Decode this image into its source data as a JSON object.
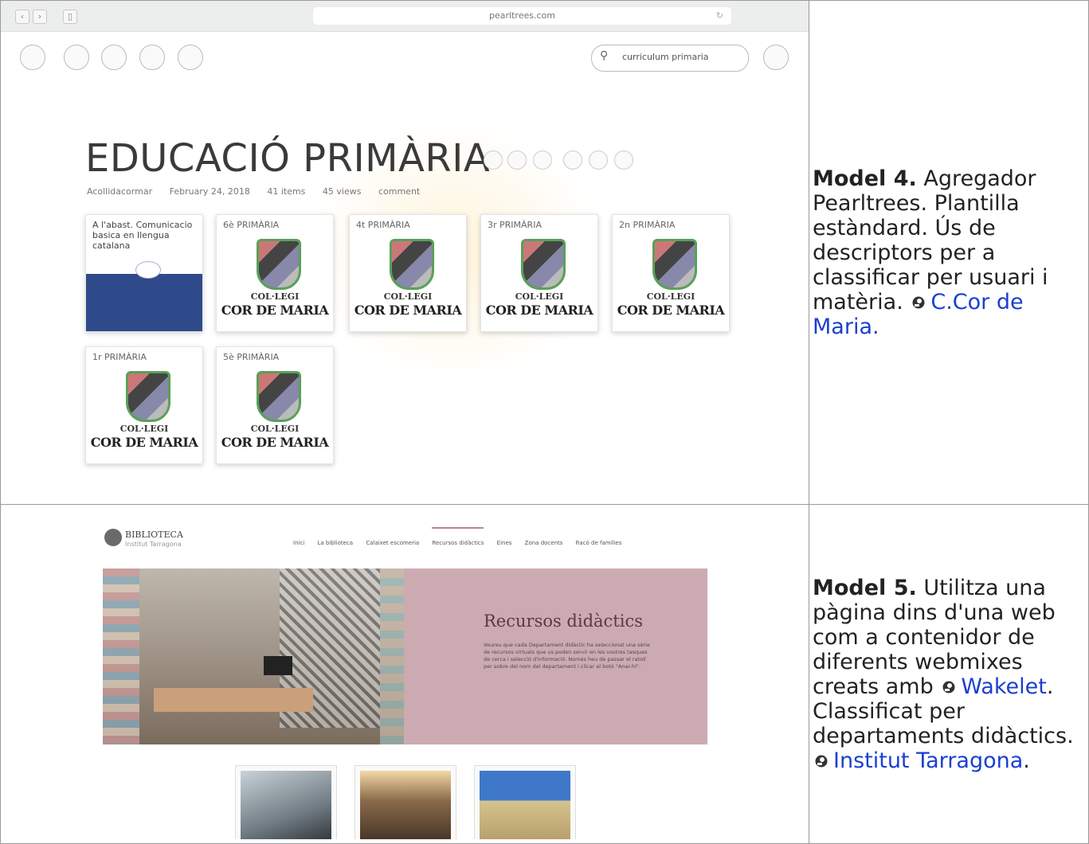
{
  "rows": [
    {
      "browser_url": "pearltrees.com",
      "search_value": "curriculum primaria",
      "title": "EDUCACIÓ PRIMÀRIA",
      "meta": {
        "author": "Acollidacormar",
        "date": "February 24, 2018",
        "items": "41 items",
        "views": "45 views",
        "comment": "comment"
      },
      "cards": [
        {
          "label": "A l'abast. Comunicacio basica en llengua catalana",
          "first": true
        },
        {
          "label": "6è PRIMÀRIA"
        },
        {
          "label": "4t PRIMÀRIA"
        },
        {
          "label": "3r PRIMÀRIA"
        },
        {
          "label": "2n PRIMÀRIA"
        },
        {
          "label": "1r PRIMÀRIA"
        },
        {
          "label": "5è PRIMÀRIA"
        }
      ],
      "card_crest_line1": "COL·LEGI",
      "card_crest_line2": "COR DE MARIA",
      "caption": {
        "bold": "Model 4.",
        "text": " Agregador Pearltrees. Plantilla estàndard. Ús de descriptors per a classificar per usuari i matèria.",
        "link": "C.Cor de Maria."
      }
    },
    {
      "logo_title": "BIBLIOTECA",
      "logo_subtitle": "Institut Tarragona",
      "menu": [
        "Inici",
        "La biblioteca",
        "Calaixet escomeria",
        "Recursos didàctics",
        "Eines",
        "Zona docents",
        "Racó de famílies"
      ],
      "hero_title": "Recursos didàctics",
      "hero_text": "Veureu que cada Departament didàctic ha seleccionat una sèrie de recursos virtuals que us poden servir en les vostres tasques de cerca i selecció d'informació. Només heu de passar el ratolí per sobre del nom del departament i clicar al botó \"Anar-hi\".",
      "caption": {
        "bold": "Model 5.",
        "text1": " Utilitza una pàgina dins d'una web com a contenidor de diferents webmixes creats amb",
        "link1": "Wakelet",
        "text2": ". Classificat per departaments didàctics.",
        "link2": "Institut Tarragona",
        "text3": "."
      }
    }
  ]
}
